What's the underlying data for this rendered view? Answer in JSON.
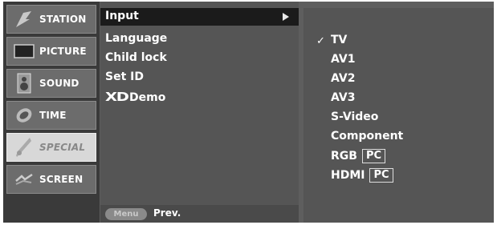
{
  "left_menu": {
    "items": [
      {
        "label": "STATION",
        "icon": "station-icon"
      },
      {
        "label": "PICTURE",
        "icon": "picture-icon"
      },
      {
        "label": "SOUND",
        "icon": "sound-icon"
      },
      {
        "label": "TIME",
        "icon": "time-icon"
      },
      {
        "label": "SPECIAL",
        "icon": "special-icon",
        "selected": true
      },
      {
        "label": "SCREEN",
        "icon": "screen-icon"
      }
    ]
  },
  "middle_menu": {
    "items": [
      {
        "label": "Input",
        "selected": true
      },
      {
        "label": "Language"
      },
      {
        "label": "Child lock"
      },
      {
        "label": "Set ID"
      },
      {
        "label": "Demo",
        "logo": "XD"
      }
    ],
    "footer": {
      "menu_button": "Menu",
      "prev_label": "Prev."
    }
  },
  "input_submenu": {
    "checked_index": 0,
    "check_mark": "✓",
    "options": [
      {
        "label": "TV"
      },
      {
        "label": "AV1"
      },
      {
        "label": "AV2"
      },
      {
        "label": "AV3"
      },
      {
        "label": "S-Video"
      },
      {
        "label": "Component"
      },
      {
        "label": "RGB",
        "badge": "PC"
      },
      {
        "label": "HDMI",
        "badge": "PC"
      }
    ]
  }
}
